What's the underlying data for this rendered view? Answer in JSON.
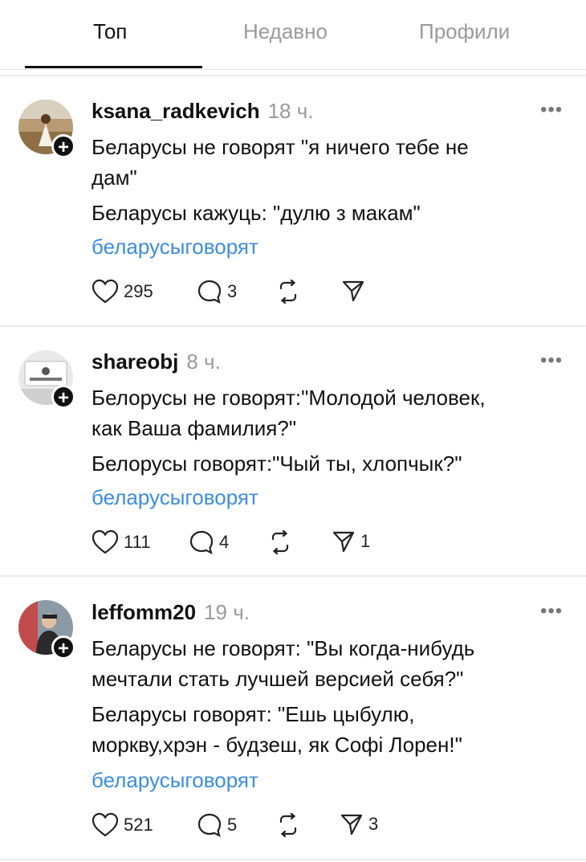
{
  "tabs": [
    "Топ",
    "Недавно",
    "Профили"
  ],
  "posts": [
    {
      "username": "ksana_radkevich",
      "time": "18 ч.",
      "lines": [
        "Беларусы не говорят \"я ничего тебе не",
        "дам\"",
        "Беларусы кажуць: \"дулю з макам\""
      ],
      "tag": "беларусыговорят",
      "likes": "295",
      "replies": "3",
      "shares": ""
    },
    {
      "username": "shareobj",
      "time": "8 ч.",
      "lines": [
        "Белорусы не говорят:\"Молодой человек,",
        "как Ваша фамилия?\"",
        "Белорусы говорят:\"Чый ты, хлопчык?\""
      ],
      "tag": "беларусыговорят",
      "likes": "111",
      "replies": "4",
      "shares": "1"
    },
    {
      "username": "leffomm20",
      "time": "19 ч.",
      "lines": [
        "Беларусы не говорят: \"Вы когда-нибудь",
        "мечтали стать лучшей версией себя?\"",
        "Беларусы говорят: \"Ешь цыбулю,",
        "моркву,хрэн - будзеш, як Софі Лорен!\""
      ],
      "tag": "беларусыговорят",
      "likes": "521",
      "replies": "5",
      "shares": "3"
    }
  ],
  "icons": {
    "like": "heart-icon",
    "reply": "comment-icon",
    "repost": "repost-icon",
    "share": "send-icon",
    "more": "more-icon",
    "follow": "plus-icon"
  },
  "colors": {
    "hashtag": "#3b8de0",
    "muted": "#9a9a9a"
  }
}
